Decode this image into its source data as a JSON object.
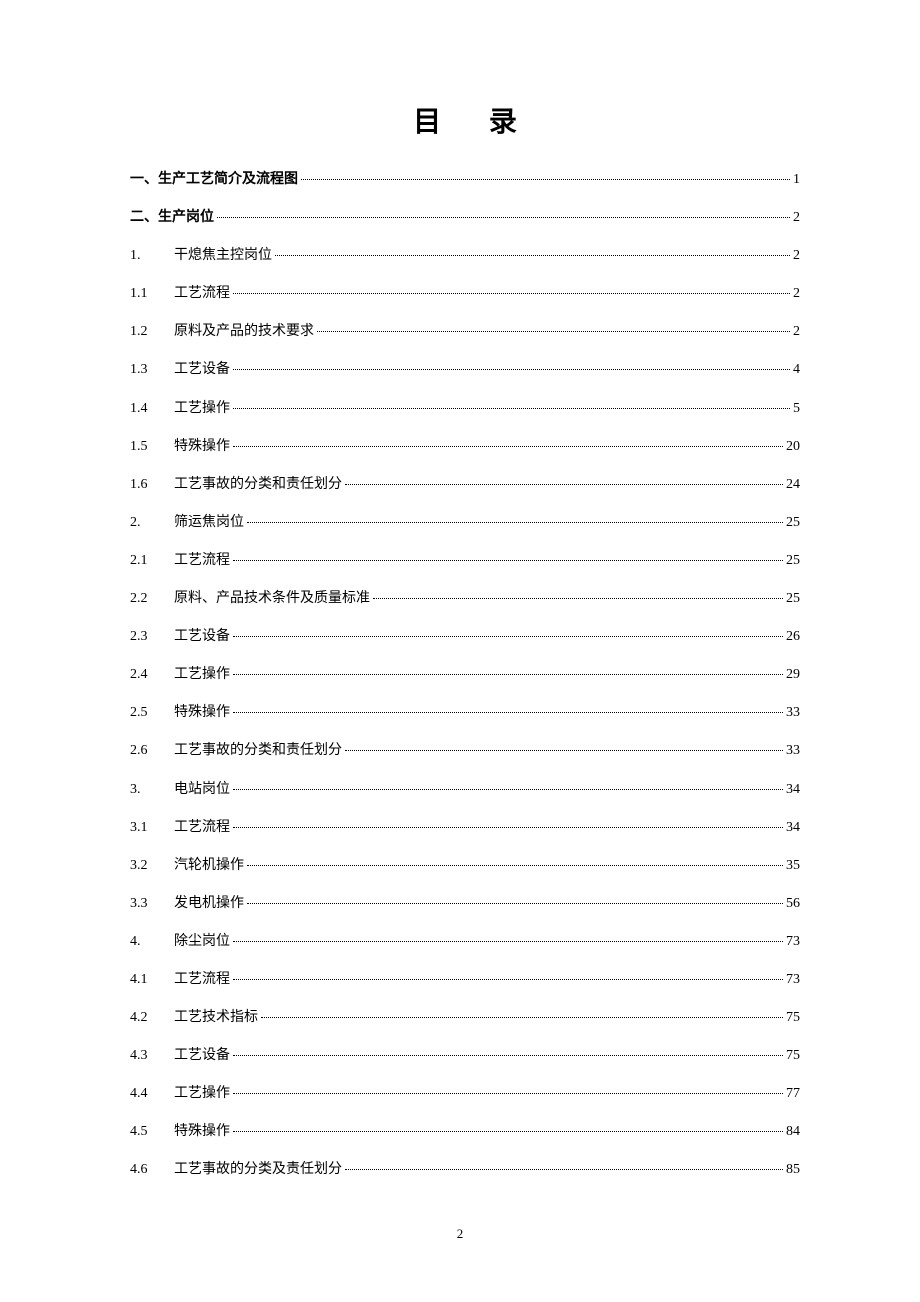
{
  "title": "目 录",
  "pageNumber": "2",
  "toc": [
    {
      "num": "",
      "label": "一、生产工艺简介及流程图",
      "page": "1",
      "bold": true,
      "noNum": true
    },
    {
      "num": "",
      "label": "二、生产岗位",
      "page": "2",
      "bold": true,
      "noNum": true
    },
    {
      "num": "1.",
      "label": "干熄焦主控岗位",
      "page": "2",
      "bold": false,
      "noNum": false
    },
    {
      "num": "1.1",
      "label": "工艺流程",
      "page": "2",
      "bold": false,
      "noNum": false
    },
    {
      "num": "1.2",
      "label": "原料及产品的技术要求",
      "page": "2",
      "bold": false,
      "noNum": false
    },
    {
      "num": "1.3",
      "label": "工艺设备",
      "page": "4",
      "bold": false,
      "noNum": false
    },
    {
      "num": "1.4",
      "label": "工艺操作",
      "page": "5",
      "bold": false,
      "noNum": false
    },
    {
      "num": "1.5",
      "label": "特殊操作",
      "page": "20",
      "bold": false,
      "noNum": false
    },
    {
      "num": "1.6",
      "label": "工艺事故的分类和责任划分",
      "page": "24",
      "bold": false,
      "noNum": false
    },
    {
      "num": "2.",
      "label": "筛运焦岗位",
      "page": "25",
      "bold": false,
      "noNum": false
    },
    {
      "num": "2.1",
      "label": "工艺流程",
      "page": "25",
      "bold": false,
      "noNum": false
    },
    {
      "num": "2.2",
      "label": "原料、产品技术条件及质量标准",
      "page": "25",
      "bold": false,
      "noNum": false
    },
    {
      "num": "2.3",
      "label": "工艺设备",
      "page": "26",
      "bold": false,
      "noNum": false
    },
    {
      "num": "2.4",
      "label": "工艺操作",
      "page": "29",
      "bold": false,
      "noNum": false
    },
    {
      "num": "2.5",
      "label": "特殊操作",
      "page": "33",
      "bold": false,
      "noNum": false
    },
    {
      "num": "2.6",
      "label": "工艺事故的分类和责任划分",
      "page": "33",
      "bold": false,
      "noNum": false
    },
    {
      "num": "3.",
      "label": "电站岗位",
      "page": "34",
      "bold": false,
      "noNum": false
    },
    {
      "num": "3.1",
      "label": "工艺流程",
      "page": "34",
      "bold": false,
      "noNum": false
    },
    {
      "num": "3.2",
      "label": "汽轮机操作",
      "page": "35",
      "bold": false,
      "noNum": false
    },
    {
      "num": "3.3",
      "label": "发电机操作",
      "page": "56",
      "bold": false,
      "noNum": false
    },
    {
      "num": "4.",
      "label": "除尘岗位",
      "page": "73",
      "bold": false,
      "noNum": false
    },
    {
      "num": "4.1",
      "label": "工艺流程",
      "page": "73",
      "bold": false,
      "noNum": false
    },
    {
      "num": "4.2",
      "label": "工艺技术指标",
      "page": "75",
      "bold": false,
      "noNum": false
    },
    {
      "num": "4.3",
      "label": "工艺设备",
      "page": "75",
      "bold": false,
      "noNum": false
    },
    {
      "num": "4.4",
      "label": "工艺操作",
      "page": "77",
      "bold": false,
      "noNum": false
    },
    {
      "num": "4.5",
      "label": "特殊操作",
      "page": "84",
      "bold": false,
      "noNum": false
    },
    {
      "num": "4.6",
      "label": "工艺事故的分类及责任划分",
      "page": "85",
      "bold": false,
      "noNum": false
    }
  ]
}
